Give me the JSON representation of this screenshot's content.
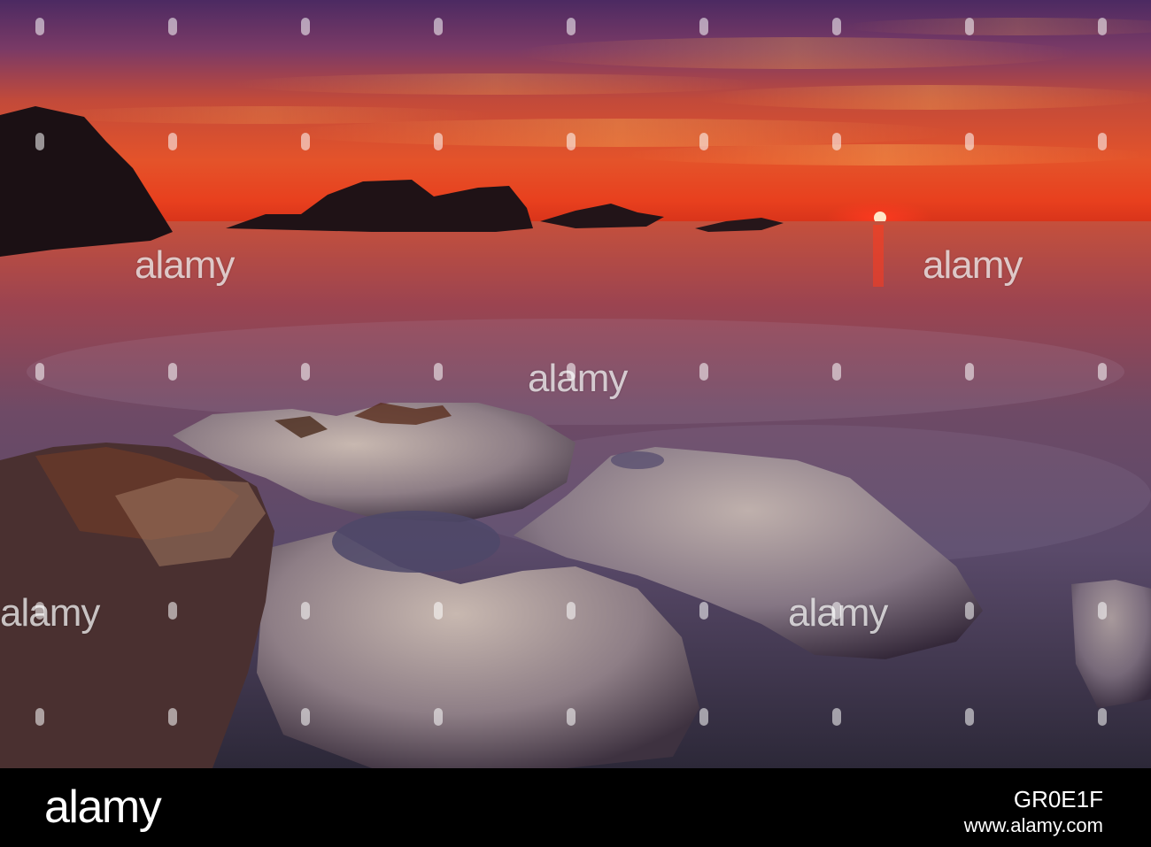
{
  "watermark": {
    "logo_text": "alamy",
    "glyph": "a"
  },
  "footer": {
    "logo_text": "alamy",
    "image_id": "GR0E1F",
    "url": "www.alamy.com"
  }
}
